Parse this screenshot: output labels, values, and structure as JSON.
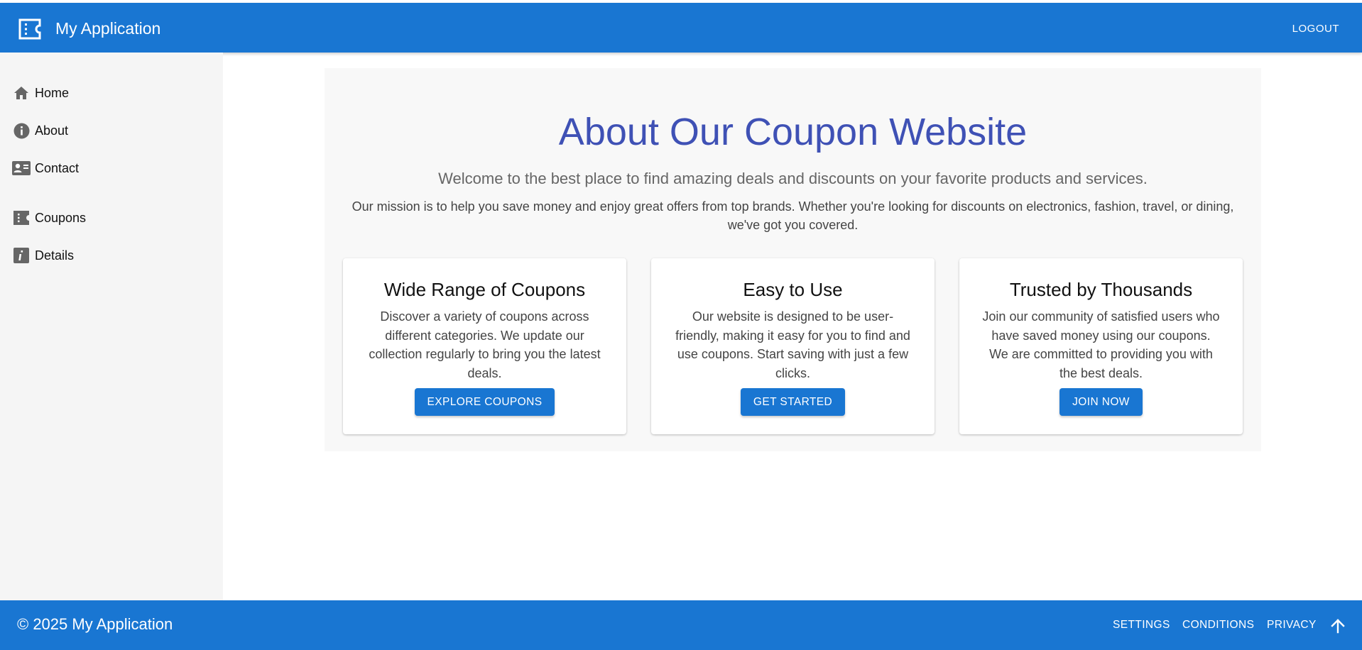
{
  "app": {
    "title": "My Application",
    "logo_icon": "coupon-ticket-icon",
    "logout_label": "LOGOUT"
  },
  "sidebar": {
    "items": [
      {
        "label": "Home",
        "icon": "home-icon"
      },
      {
        "label": "About",
        "icon": "info-circle-icon"
      },
      {
        "label": "Contact",
        "icon": "contact-card-icon"
      },
      {
        "label": "Coupons",
        "icon": "coupon-icon"
      },
      {
        "label": "Details",
        "icon": "info-box-icon"
      }
    ]
  },
  "main": {
    "title": "About Our Coupon Website",
    "subtitle": "Welcome to the best place to find amazing deals and discounts on your favorite products and services.",
    "mission": "Our mission is to help you save money and enjoy great offers from top brands. Whether you're looking for discounts on electronics, fashion, travel, or dining, we've got you covered.",
    "cards": [
      {
        "title": "Wide Range of Coupons",
        "text": "Discover a variety of coupons across different categories. We update our collection regularly to bring you the latest deals.",
        "button": "EXPLORE COUPONS"
      },
      {
        "title": "Easy to Use",
        "text": "Our website is designed to be user-friendly, making it easy for you to find and use coupons. Start saving with just a few clicks.",
        "button": "GET STARTED"
      },
      {
        "title": "Trusted by Thousands",
        "text": "Join our community of satisfied users who have saved money using our coupons. We are committed to providing you with the best deals.",
        "button": "JOIN NOW"
      }
    ]
  },
  "footer": {
    "copyright": "© 2025 My Application",
    "links": [
      "SETTINGS",
      "CONDITIONS",
      "PRIVACY"
    ],
    "scroll_top_icon": "arrow-up-icon"
  },
  "colors": {
    "primary": "#1976d2",
    "title_accent": "#3f51b5",
    "sidebar_bg": "#f5f5f5",
    "panel_bg": "#f8f8f8"
  }
}
